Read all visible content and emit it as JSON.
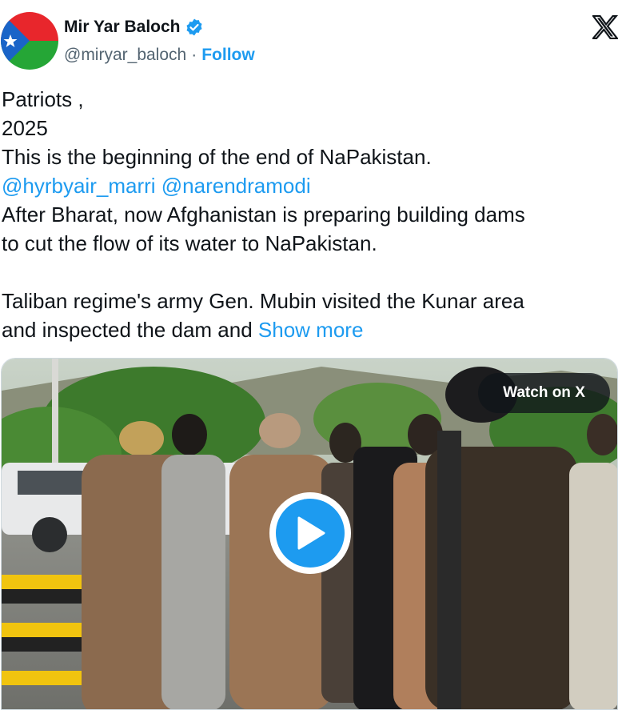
{
  "author": {
    "name": "Mir Yar Baloch",
    "handle": "@miryar_baloch",
    "separator": "·",
    "follow_label": "Follow",
    "verified_icon": "verified-badge-icon",
    "avatar_colors": {
      "top": "#e8262c",
      "bottom": "#25a636",
      "left": "#1a64c8"
    }
  },
  "platform_icon": "x-logo-icon",
  "tweet": {
    "lines": [
      "Patriots ,",
      "2025",
      "This is the beginning of the end of NaPakistan."
    ],
    "mentions": [
      "@hyrbyair_marri",
      "@narendramodi"
    ],
    "lines_after": [
      "After Bharat, now Afghanistan is preparing building dams",
      "to cut the flow of its water to NaPakistan."
    ],
    "lines_para2": [
      "Taliban regime's army Gen. Mubin visited the Kunar area"
    ],
    "last_line_prefix": "and inspected the dam and",
    "show_more": "Show more"
  },
  "media": {
    "watch_label": "Watch on X",
    "play_icon": "play-icon"
  },
  "colors": {
    "accent": "#1d9bf0",
    "text": "#0f1419",
    "secondary": "#536471"
  }
}
